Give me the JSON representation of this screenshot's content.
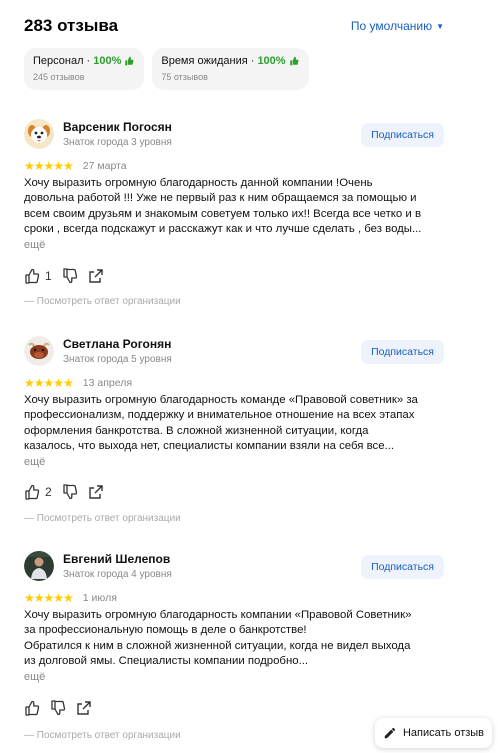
{
  "header": {
    "review_count": "283 отзыва",
    "sort_label": "По умолчанию"
  },
  "chips": [
    {
      "label": "Персонал ·",
      "pct": "100%",
      "sub": "245 отзывов"
    },
    {
      "label": "Время ожидания ·",
      "pct": "100%",
      "sub": "75 отзывов"
    }
  ],
  "reviews": [
    {
      "author": "Варсеник Погосян",
      "level": "Знаток города 3 уровня",
      "subscribe": "Подписаться",
      "stars": "★★★★★",
      "rating": 5,
      "date": "27 марта",
      "lines": [
        "Хочу выразить огромную благодарность данной компании !Очень",
        "довольна работой !!! Уже не первый раз к ним обращаемся за помощью и",
        "всем своим друзьям и знакомым советуем только их!! Всегда все четко и в",
        "сроки , всегда подскажут и расскажут как и что лучше сделать , без воды..."
      ],
      "more": "ещё",
      "likes": "1",
      "org_answer": "— Посмотреть ответ организации",
      "avatar_icon": "dog-avatar"
    },
    {
      "author": "Светлана Рогонян",
      "level": "Знаток города 5 уровня",
      "subscribe": "Подписаться",
      "stars": "★★★★★",
      "rating": 5,
      "date": "13 апреля",
      "lines": [
        "Хочу выразить огромную благодарность команде «Правовой советник» за",
        "профессионализм, поддержку и внимательное отношение на всех этапах",
        "оформления банкротства. В сложной жизненной ситуации, когда",
        "казалось, что выхода нет, специалисты компании взяли на себя все..."
      ],
      "more": "ещё",
      "likes": "2",
      "org_answer": "— Посмотреть ответ организации",
      "avatar_icon": "bull-avatar"
    },
    {
      "author": "Евгений Шелепов",
      "level": "Знаток города 4 уровня",
      "subscribe": "Подписаться",
      "stars": "★★★★★",
      "rating": 5,
      "date": "1 июля",
      "lines": [
        "Хочу выразить огромную благодарность компании «Правовой Советник»",
        "за профессиональную помощь в деле о банкротстве!",
        "Обратился к ним в сложной жизненной ситуации, когда не видел выхода",
        "из долговой ямы. Специалисты компании подробно..."
      ],
      "more": "ещё",
      "likes": "",
      "org_answer": "— Посмотреть ответ организации",
      "avatar_icon": "photo-avatar"
    }
  ],
  "write_review_label": "Написать отзыв",
  "colors": {
    "accent": "#1a5fbf",
    "star": "#ffcc00",
    "positive": "#2f9e2f"
  }
}
